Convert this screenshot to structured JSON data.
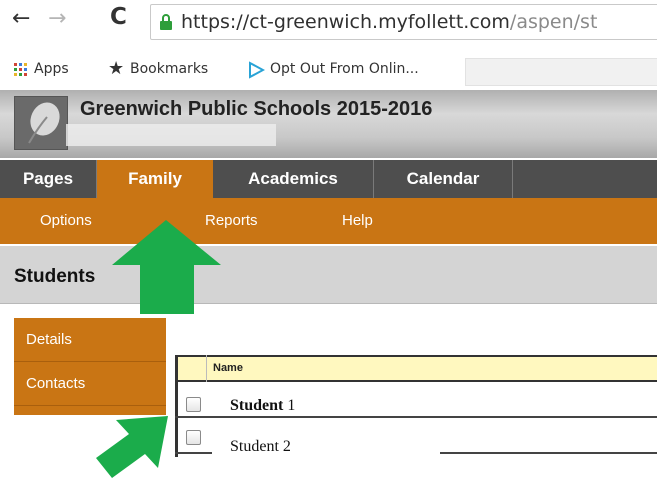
{
  "browser": {
    "back_icon": "←",
    "forward_icon": "→",
    "reload_icon": "C",
    "url_host": "https://ct-greenwich.myfollett.com",
    "url_path": "/aspen/st",
    "bookmarks": [
      {
        "label": "Apps",
        "icon": "apps-grid-icon"
      },
      {
        "label": "Bookmarks",
        "icon": "star-icon"
      },
      {
        "label": "Opt Out From Onlin...",
        "icon": "play-icon"
      }
    ]
  },
  "header": {
    "school_title": "Greenwich Public Schools 2015-2016",
    "logo_icon": "leaf-logo-icon"
  },
  "tabs": [
    "Pages",
    "Family",
    "Academics",
    "Calendar"
  ],
  "active_tab": "Family",
  "submenu": [
    "Options",
    "Reports",
    "Help"
  ],
  "page": {
    "title": "Students"
  },
  "side_nav": [
    "Details",
    "Contacts"
  ],
  "table": {
    "column_name": "Name",
    "rows": [
      {
        "bold": "Student",
        "rest": " 1"
      },
      {
        "bold": "",
        "rest": "Student 2"
      }
    ]
  },
  "colors": {
    "accent": "#c97514",
    "tab_bar": "#4e4e4e",
    "arrow": "#1bac4b",
    "header_row": "#fff8bf"
  }
}
